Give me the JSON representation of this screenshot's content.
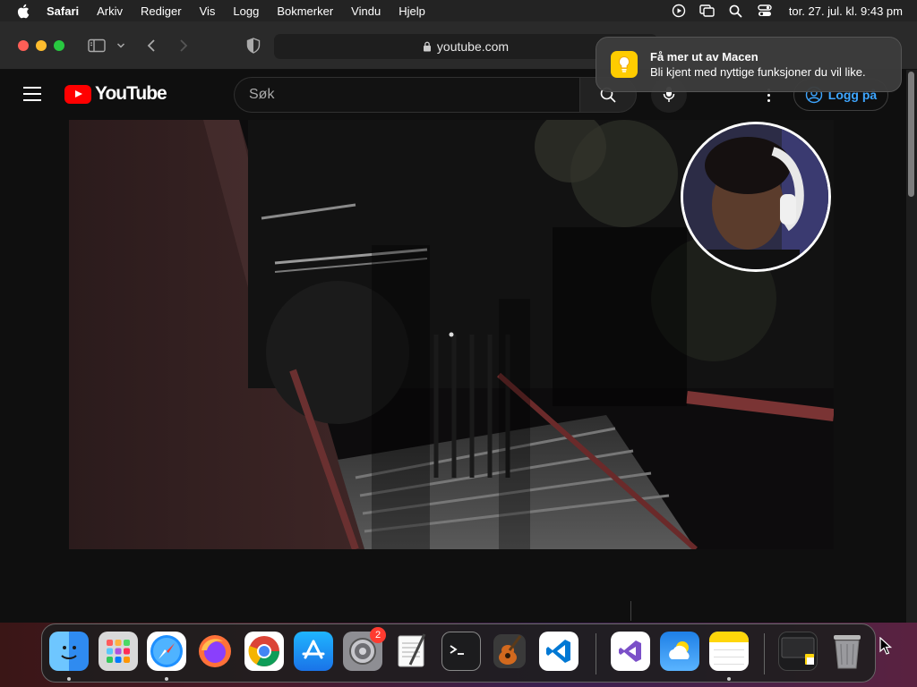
{
  "menubar": {
    "app": "Safari",
    "items": [
      "Arkiv",
      "Rediger",
      "Vis",
      "Logg",
      "Bokmerker",
      "Vindu",
      "Hjelp"
    ],
    "clock": "tor. 27. jul. kl. 9:43 pm"
  },
  "browser": {
    "address": "youtube.com"
  },
  "youtube": {
    "logo_text": "YouTube",
    "search_placeholder": "Søk",
    "signin_label": "Logg på"
  },
  "notification": {
    "title": "Få mer ut av Macen",
    "message": "Bli kjent med nyttige funksjoner du vil like."
  },
  "dock": {
    "settings_badge": "2",
    "items": [
      "finder",
      "launchpad",
      "safari",
      "firefox",
      "chrome",
      "app-store",
      "system-settings",
      "textedit",
      "terminal",
      "garageband",
      "vscode",
      "visual-studio",
      "weather",
      "notes",
      "downloads",
      "trash"
    ]
  },
  "colors": {
    "accent_blue": "#3ea6ff",
    "youtube_red": "#ff0000"
  }
}
